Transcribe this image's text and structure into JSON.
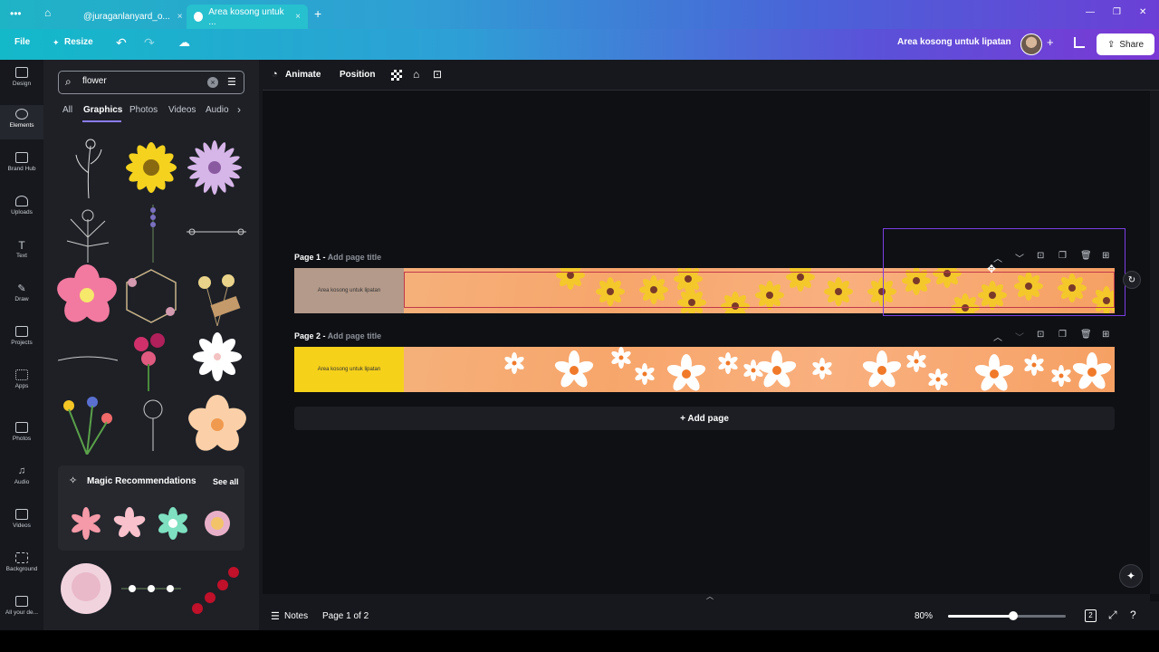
{
  "browser": {
    "menu_icon": "dots-menu-icon",
    "tabs": [
      {
        "label": "@juraganlanyard_o...",
        "close": "×"
      },
      {
        "label": "Area kosong untuk ...",
        "close": "×"
      }
    ],
    "new_tab": "+",
    "window_controls": [
      "—",
      "❐",
      "✕"
    ]
  },
  "header": {
    "file_label": "File",
    "resize_label": "Resize",
    "undo": "↶",
    "redo": "↷",
    "cloud": "☁",
    "doc_title": "Area kosong untuk lipatan",
    "add": "+",
    "share_label": "Share"
  },
  "rail": {
    "items": [
      {
        "label": "Design"
      },
      {
        "label": "Elements"
      },
      {
        "label": "Brand Hub"
      },
      {
        "label": "Uploads"
      },
      {
        "label": "Text"
      },
      {
        "label": "Draw"
      },
      {
        "label": "Projects"
      },
      {
        "label": "Apps"
      },
      {
        "label": "Photos"
      },
      {
        "label": "Audio"
      },
      {
        "label": "Videos"
      },
      {
        "label": "Background"
      },
      {
        "label": "All your de..."
      }
    ]
  },
  "panel": {
    "search_value": "flower",
    "tabs": [
      {
        "label": "All"
      },
      {
        "label": "Graphics"
      },
      {
        "label": "Photos"
      },
      {
        "label": "Videos"
      },
      {
        "label": "Audio"
      }
    ],
    "more": "›",
    "magic_title": "Magic Recommendations",
    "see_all": "See all"
  },
  "toolbar": {
    "animate_label": "Animate",
    "position_label": "Position"
  },
  "canvas": {
    "page1_label": "Page 1 -",
    "page1_sub": "Add page title",
    "page2_label": "Page 2 -",
    "page2_sub": "Add page title",
    "band_text": "Area kosong untuk lipatan",
    "add_page_label": "+ Add page"
  },
  "bottombar": {
    "notes_label": "Notes",
    "page_indicator": "Page 1 of 2",
    "zoom_value": "80%",
    "zoom_fraction": 0.55,
    "page_count": "2"
  },
  "colors": {
    "accent_purple": "#7b3fe4",
    "band_orange": "#f7a66b",
    "band_yellow": "#f6d11a"
  }
}
